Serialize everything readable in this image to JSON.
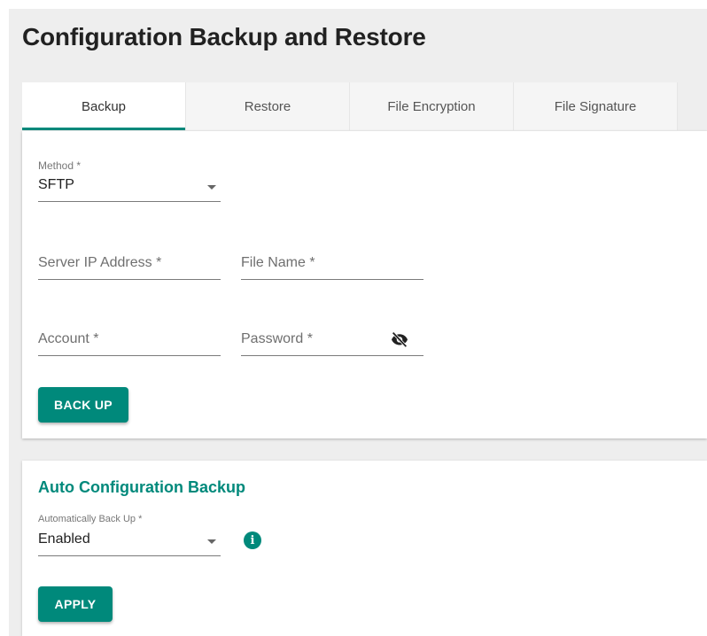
{
  "page": {
    "title": "Configuration Backup and Restore"
  },
  "tabs": [
    {
      "label": "Backup",
      "active": true
    },
    {
      "label": "Restore",
      "active": false
    },
    {
      "label": "File Encryption",
      "active": false
    },
    {
      "label": "File Signature",
      "active": false
    }
  ],
  "backup": {
    "method_label": "Method *",
    "method_value": "SFTP",
    "server_ip_placeholder": "Server IP Address *",
    "file_name_placeholder": "File Name *",
    "account_placeholder": "Account *",
    "password_placeholder": "Password *",
    "password_visibility_icon": "eye-off-icon",
    "back_up_label": "BACK UP"
  },
  "auto_backup": {
    "title": "Auto Configuration Backup",
    "auto_label": "Automatically Back Up *",
    "auto_value": "Enabled",
    "info_icon": "info-icon",
    "apply_label": "APPLY"
  },
  "colors": {
    "accent": "#00897b",
    "background": "#eeeeee",
    "card": "#ffffff"
  }
}
